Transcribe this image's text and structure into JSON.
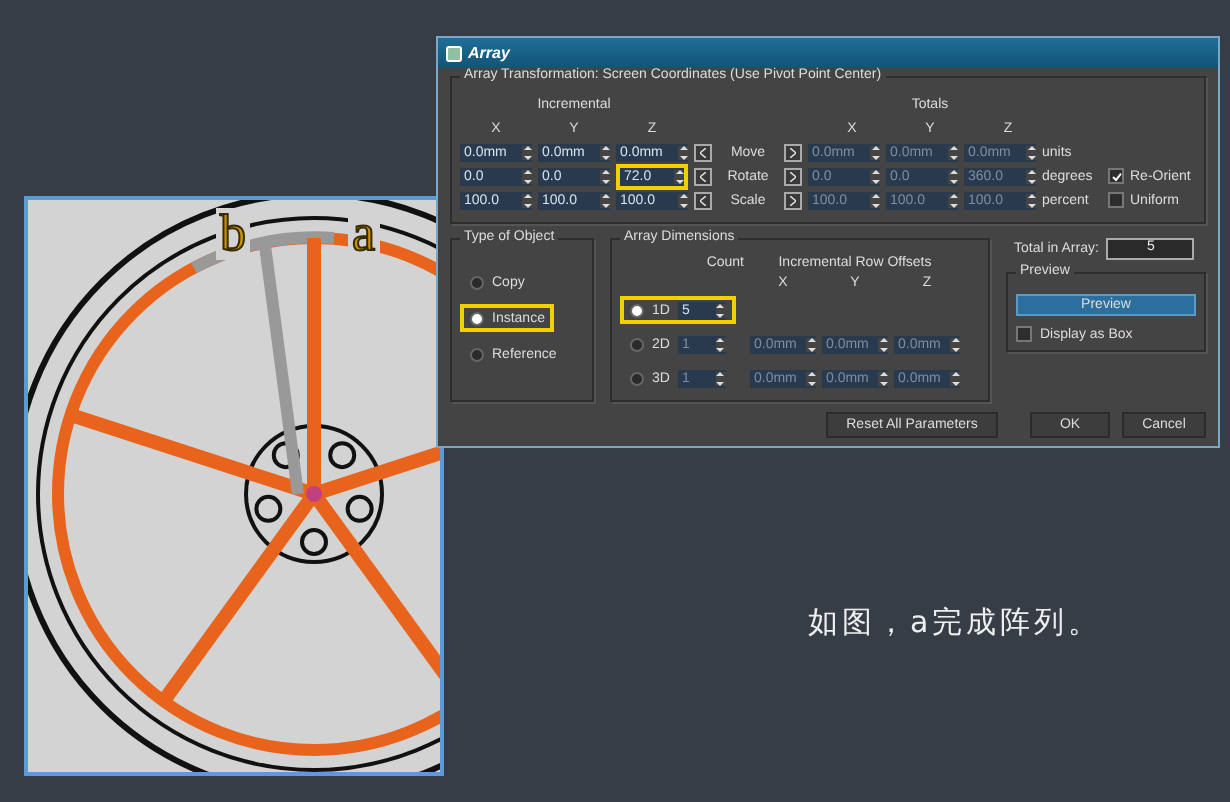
{
  "wheel_view": {
    "labels": [
      {
        "text": "b",
        "kind": "copy"
      },
      {
        "text": "a",
        "kind": "source"
      }
    ]
  },
  "dialog": {
    "title": "Array",
    "transform": {
      "title": "Array Transformation: Screen Coordinates (Use Pivot Point Center)",
      "incremental_label": "Incremental",
      "totals_label": "Totals",
      "incremental_axes": [
        "X",
        "Y",
        "Z"
      ],
      "totals_axes": [
        "X",
        "Y",
        "Z"
      ],
      "rows": [
        {
          "label": "Move",
          "incremental": [
            {
              "value": "0.0mm",
              "highlighted": false
            },
            {
              "value": "0.0mm",
              "highlighted": false
            },
            {
              "value": "0.0mm",
              "highlighted": false
            }
          ],
          "totals": [
            "0.0mm",
            "0.0mm",
            "0.0mm"
          ],
          "unit": "units"
        },
        {
          "label": "Rotate",
          "incremental": [
            {
              "value": "0.0",
              "highlighted": false
            },
            {
              "value": "0.0",
              "highlighted": false
            },
            {
              "value": "72.0",
              "highlighted": true
            }
          ],
          "totals": [
            "0.0",
            "0.0",
            "360.0"
          ],
          "unit": "degrees",
          "option": {
            "label": "Re-Orient",
            "checked": true
          }
        },
        {
          "label": "Scale",
          "incremental": [
            {
              "value": "100.0",
              "highlighted": false
            },
            {
              "value": "100.0",
              "highlighted": false
            },
            {
              "value": "100.0",
              "highlighted": false
            }
          ],
          "totals": [
            "100.0",
            "100.0",
            "100.0"
          ],
          "unit": "percent",
          "option": {
            "label": "Uniform",
            "checked": false
          }
        }
      ]
    },
    "type_of_object": {
      "title": "Type of Object",
      "options": [
        {
          "label": "Copy",
          "selected": false,
          "highlighted": false
        },
        {
          "label": "Instance",
          "selected": true,
          "highlighted": true
        },
        {
          "label": "Reference",
          "selected": false,
          "highlighted": false
        }
      ]
    },
    "array_dimensions": {
      "title": "Array Dimensions",
      "count_label": "Count",
      "offsets_label": "Incremental Row Offsets",
      "axes": [
        "X",
        "Y",
        "Z"
      ],
      "rows": [
        {
          "label": "1D",
          "selected": true,
          "count": "5",
          "highlighted": true,
          "offsets": []
        },
        {
          "label": "2D",
          "selected": false,
          "count": "1",
          "highlighted": false,
          "offsets": [
            "0.0mm",
            "0.0mm",
            "0.0mm"
          ]
        },
        {
          "label": "3D",
          "selected": false,
          "count": "1",
          "highlighted": false,
          "offsets": [
            "0.0mm",
            "0.0mm",
            "0.0mm"
          ]
        }
      ]
    },
    "total": {
      "label": "Total in Array:",
      "value": "5"
    },
    "preview": {
      "title": "Preview",
      "button": "Preview",
      "display_as_box": {
        "label": "Display as Box",
        "checked": false
      }
    },
    "buttons": {
      "reset": "Reset All Parameters",
      "ok": "OK",
      "cancel": "Cancel"
    }
  },
  "caption": "如图，a完成阵列。"
}
